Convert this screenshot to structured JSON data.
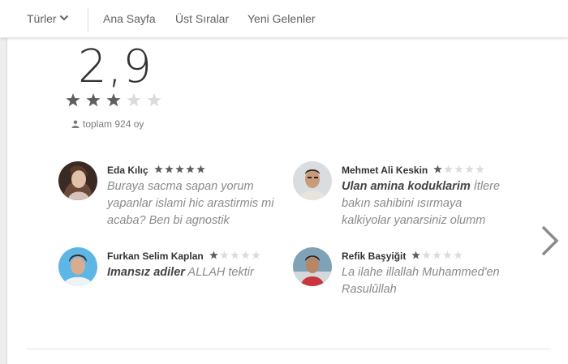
{
  "nav": {
    "genres_label": "Türler",
    "home_label": "Ana Sayfa",
    "top_label": "Üst Sıralar",
    "new_label": "Yeni Gelenler"
  },
  "rating": {
    "score": "2,9",
    "stars": 3,
    "max_stars": 5,
    "total": "toplam 924 oy"
  },
  "reviews": [
    {
      "name": "Eda Kılıç",
      "stars": 5,
      "highlight": "",
      "text": "Buraya sacma sapan yorum yapanlar islami hic arastirmis mi acaba? Ben bi agnostik"
    },
    {
      "name": "Mehmet Ali Keskin",
      "stars": 1,
      "highlight": "Ulan amina koduklarim",
      "text": " İtlere bakın sahibini ısırmaya kalkiyolar yanarsiniz olumm"
    },
    {
      "name": "Furkan Selim Kaplan",
      "stars": 1,
      "highlight": "Imansız adiler",
      "text": " ALLAH tektir"
    },
    {
      "name": "Refik Başyiğit",
      "stars": 1,
      "highlight": "",
      "text": "La ilahe illallah Muhammed'en Rasulûllah"
    }
  ],
  "colors": {
    "star_filled": "#5f5f5f",
    "star_empty": "#dcdcdc",
    "text_muted": "#8a8a8a"
  },
  "icons": {
    "dropdown": "chevron-down-icon",
    "total": "person-icon",
    "next": "chevron-right-icon"
  }
}
